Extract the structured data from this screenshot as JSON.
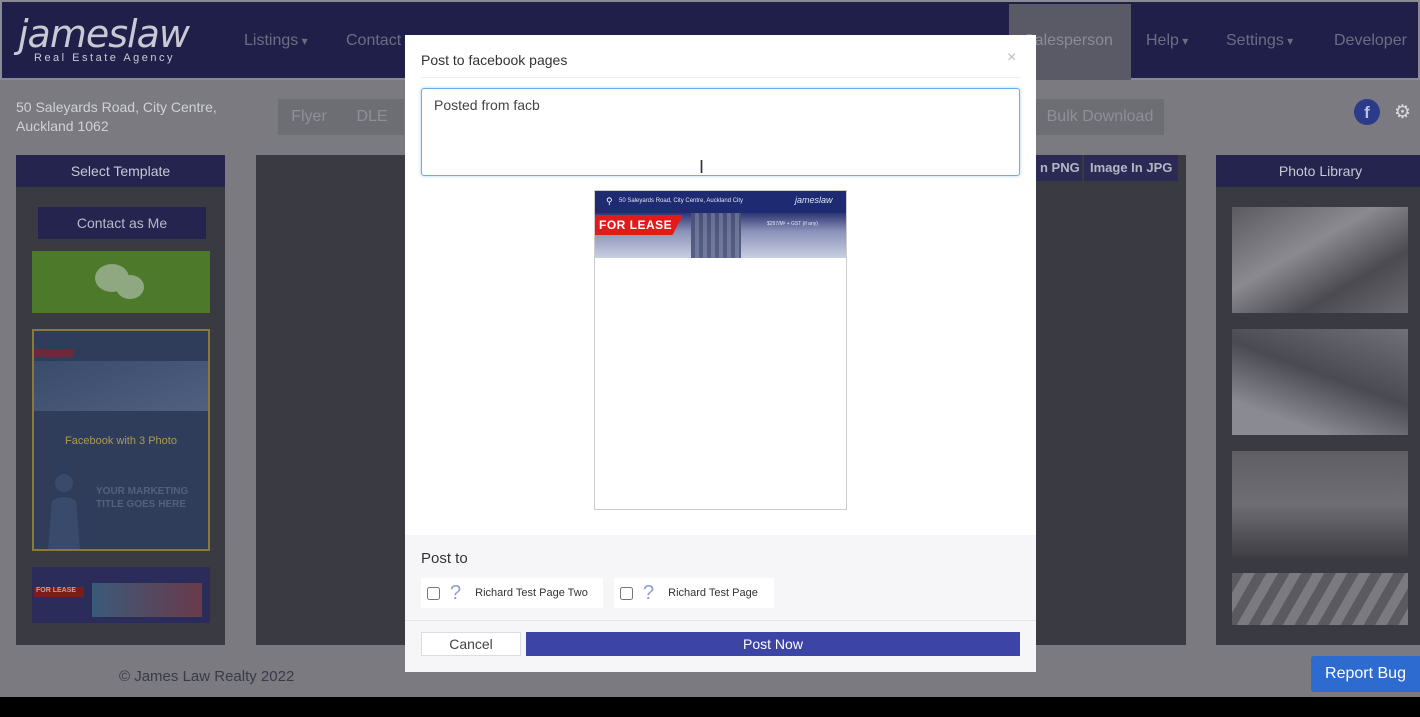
{
  "header": {
    "logo_main": "jameslaw",
    "logo_sub": "Real Estate Agency",
    "nav": [
      "Listings",
      "Contact",
      "Salesperson",
      "Help",
      "Settings",
      "Developer"
    ]
  },
  "subbar": {
    "address_line1": "50 Saleyards Road, City Centre,",
    "address_line2": "Auckland 1062",
    "tools": [
      "Flyer",
      "DLE",
      "Bulk Download"
    ],
    "facebook_icon": "f",
    "settings_icon": "gear-icon"
  },
  "left_panel": {
    "title": "Select Template",
    "contact_button": "Contact as Me",
    "template_label": "Facebook with 3 Photo",
    "template_text_1": "YOUR MARKETING",
    "template_text_2": "TITLE GOES HERE",
    "strip_text": "FOR LEASE"
  },
  "center": {
    "image_buttons": [
      "Image In PNG",
      "Image In JPG"
    ]
  },
  "right_panel": {
    "title": "Photo Library"
  },
  "footer": {
    "copyright": "© James Law Realty 2022",
    "report_bug": "Report Bug"
  },
  "modal": {
    "title": "Post to facebook pages",
    "close": "×",
    "message_value": "Posted from facb",
    "preview": {
      "address": "50 Saleyards Road, City Centre, Auckland City",
      "logo": "jameslaw",
      "badge": "FOR LEASE",
      "price": "$297/M² + GST (if any)"
    },
    "post_to_label": "Post to",
    "pages": [
      {
        "label": "Richard Test Page Two",
        "checked": false
      },
      {
        "label": "Richard Test Page",
        "checked": false
      }
    ],
    "cancel_label": "Cancel",
    "post_label": "Post Now"
  },
  "colors": {
    "navbar": "#1f1f4a",
    "accent": "#3c45a6",
    "report_bug": "#2d6bd0",
    "lease_red": "#e31a1a"
  }
}
